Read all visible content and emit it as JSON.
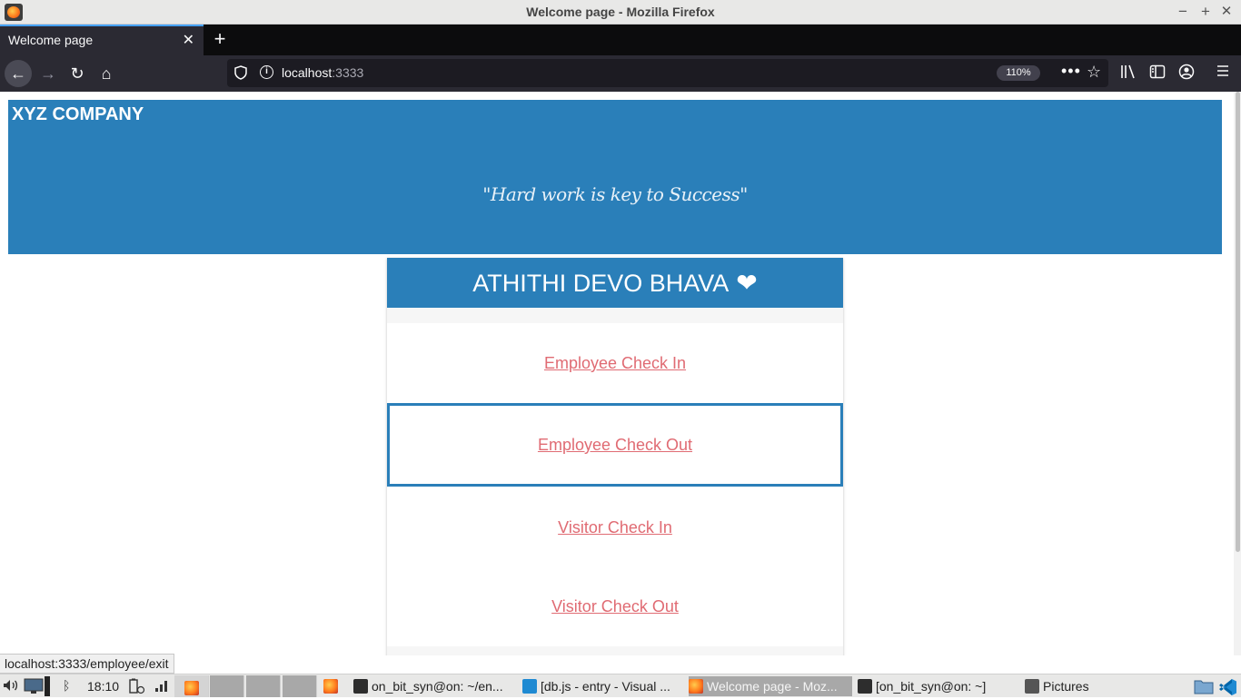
{
  "window": {
    "title": "Welcome page - Mozilla Firefox",
    "minimize_glyph": "−",
    "maximize_glyph": "+",
    "close_glyph": "✕"
  },
  "browser": {
    "tab": {
      "title": "Welcome page",
      "close_glyph": "✕"
    },
    "newtab_glyph": "+",
    "nav": {
      "back_glyph": "←",
      "forward_glyph": "→",
      "reload_glyph": "↻",
      "home_glyph": "⌂"
    },
    "url": {
      "host": "localhost",
      "port": ":3333"
    },
    "zoom": "110%",
    "more_glyph": "•••",
    "star_glyph": "☆",
    "status_link": "localhost:3333/employee/exit"
  },
  "page": {
    "company": "XYZ COMPANY",
    "motto": "\"Hard work is key to Success\"",
    "card": {
      "heading": "ATHITHI DEVO BHAVA",
      "heart_glyph": "❤",
      "links": [
        {
          "label": "Employee Check In"
        },
        {
          "label": "Employee Check Out"
        },
        {
          "label": "Visitor Check In"
        },
        {
          "label": "Visitor Check Out"
        }
      ]
    }
  },
  "taskbar": {
    "clock": "18:10",
    "tasks": [
      {
        "label": "on_bit_syn@on: ~/en..."
      },
      {
        "label": "[db.js - entry - Visual ..."
      },
      {
        "label": "Welcome page - Moz..."
      },
      {
        "label": "[on_bit_syn@on: ~]"
      },
      {
        "label": "Pictures"
      }
    ]
  },
  "colors": {
    "brand_blue": "#2a7fb9",
    "link_red": "#e06b73",
    "browser_dark": "#2b2a33"
  },
  "icons": [
    "firefox-icon",
    "shield-icon",
    "info-icon",
    "library-icon",
    "sidebar-icon",
    "account-icon",
    "menu-icon",
    "volume-icon",
    "bluetooth-icon",
    "network-icon",
    "terminal-icon",
    "vscode-icon",
    "folder-icon"
  ]
}
